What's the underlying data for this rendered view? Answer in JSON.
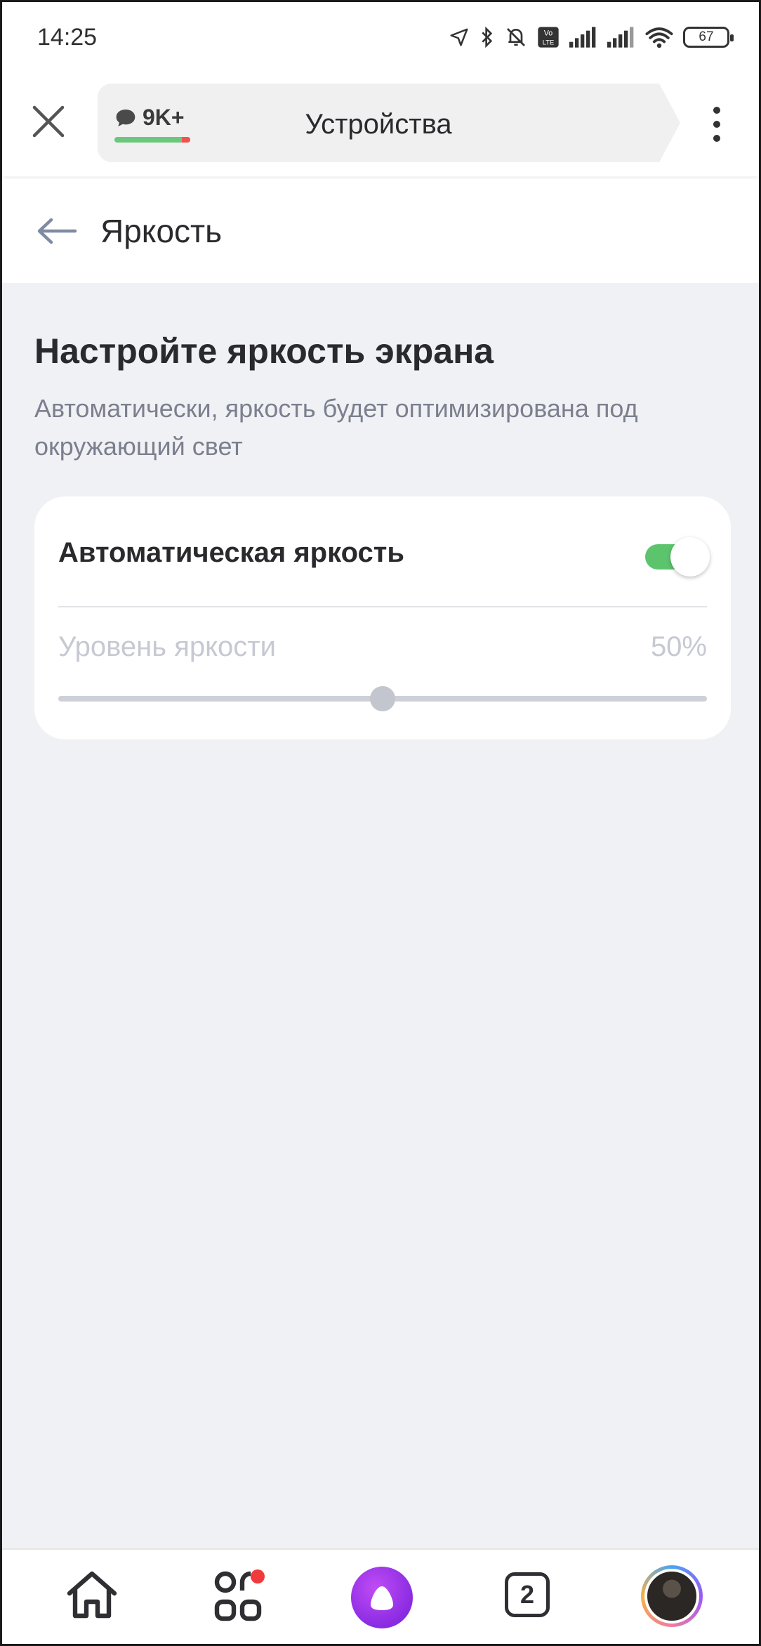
{
  "status_bar": {
    "time": "14:25",
    "battery": "67",
    "icons": [
      "location-icon",
      "bluetooth-icon",
      "mute-icon",
      "volte-icon",
      "signal-icon",
      "signal-icon",
      "wifi-icon",
      "battery-icon"
    ]
  },
  "header": {
    "badge_count": "9K+",
    "tab_title": "Устройства"
  },
  "subheader": {
    "title": "Яркость"
  },
  "section": {
    "title": "Настройте яркость экрана",
    "description": "Автоматически, яркость будет оптимизирована под окружающий свет"
  },
  "settings": {
    "auto_brightness_label": "Автоматическая яркость",
    "auto_brightness_on": true,
    "level_label": "Уровень яркости",
    "level_value": "50%",
    "level_fraction": 0.5
  },
  "bottom_nav": {
    "tabs_count": "2"
  },
  "colors": {
    "toggle_on": "#5cc46d",
    "background": "#f0f1f4",
    "alice": "#8a2be2",
    "notification_dot": "#ef3b3b"
  }
}
